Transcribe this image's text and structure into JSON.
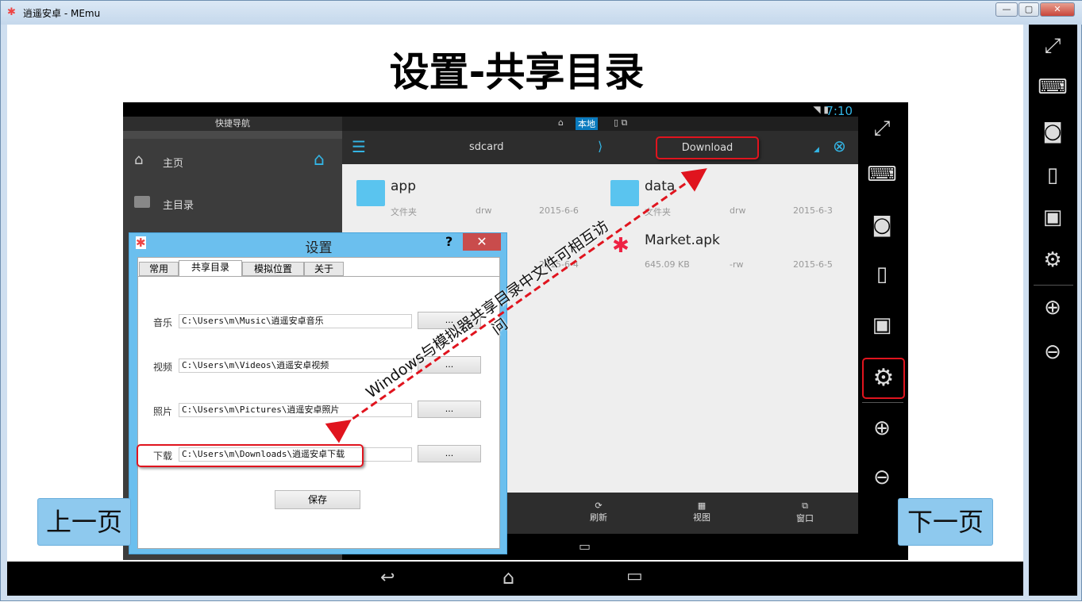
{
  "window": {
    "title": "逍遥安卓 - MEmu",
    "controls": [
      "—",
      "▢",
      "✕"
    ]
  },
  "slide": {
    "title": "设置-共享目录",
    "prev": "上一页",
    "next": "下一页",
    "annotation": "Windows与模拟器共享目录中文件可相互访问"
  },
  "android": {
    "time": "7:10",
    "nav_header": "快捷导航",
    "nav_items": [
      "主页",
      "主目录"
    ],
    "location_tab": "本地",
    "path_root": "sdcard",
    "path_current": "Download",
    "files": [
      {
        "name": "app",
        "type": "文件夹",
        "perm": "drw",
        "date": "2015-6-6"
      },
      {
        "name": "data",
        "type": "文件夹",
        "perm": "drw",
        "date": "2015-6-3"
      },
      {
        "name": "Market.apk",
        "type": "645.09 KB",
        "perm": "-rw",
        "date": "2015-6-5"
      },
      {
        "date": "2015-6-4"
      }
    ],
    "toolbar": [
      "刷新",
      "视图",
      "窗口"
    ]
  },
  "dialog": {
    "title": "设置",
    "help": "?",
    "tabs": [
      "常用",
      "共享目录",
      "模拟位置",
      "关于"
    ],
    "active_tab": 1,
    "rows": [
      {
        "label": "音乐",
        "path": "C:\\Users\\m\\Music\\逍遥安卓音乐"
      },
      {
        "label": "视频",
        "path": "C:\\Users\\m\\Videos\\逍遥安卓视频"
      },
      {
        "label": "照片",
        "path": "C:\\Users\\m\\Pictures\\逍遥安卓照片"
      },
      {
        "label": "下载",
        "path": "C:\\Users\\m\\Downloads\\逍遥安卓下载"
      }
    ],
    "browse": "...",
    "save": "保存"
  },
  "colors": {
    "accent": "#33b5e5",
    "highlight": "#e0141e",
    "dialog_title": "#6bbfee"
  }
}
